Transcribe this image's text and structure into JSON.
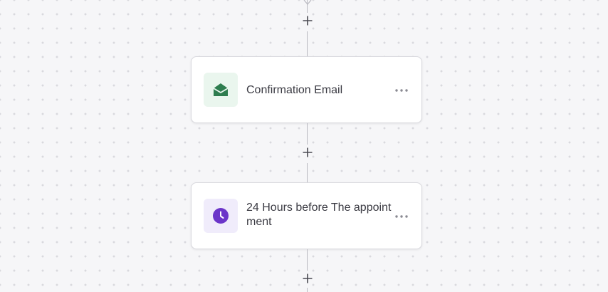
{
  "workflow": {
    "nodes": [
      {
        "title": "Confirmation Email",
        "icon": "envelope-open-icon",
        "icon_color": "#2e7d4f",
        "icon_bg": "#eaf6ee"
      },
      {
        "title": "24 Hours before The appointment",
        "icon": "clock-icon",
        "icon_color": "#6b35c9",
        "icon_bg": "#f0ecfb"
      }
    ],
    "connector_color": "#b9b9c0",
    "add_step_icon": "plus-icon",
    "more_icon": "ellipsis-icon"
  }
}
